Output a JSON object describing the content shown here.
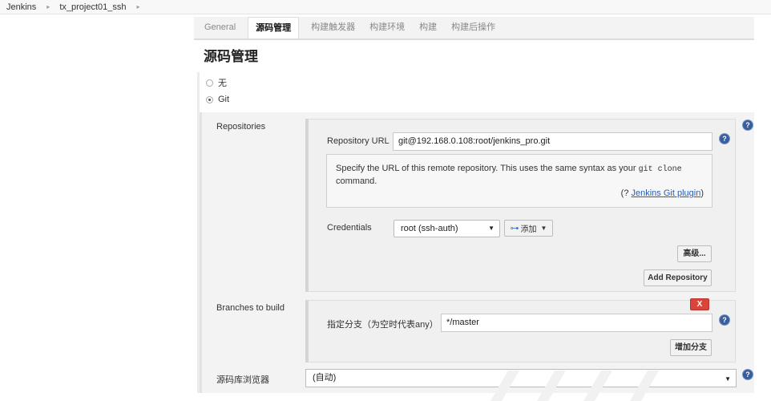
{
  "breadcrumb": {
    "items": [
      "Jenkins",
      "tx_project01_ssh"
    ]
  },
  "tabs": [
    "General",
    "源码管理",
    "构建触发器",
    "构建环境",
    "构建",
    "构建后操作"
  ],
  "active_tab_index": 1,
  "section_title": "源码管理",
  "scm_options": [
    {
      "label": "无",
      "checked": false
    },
    {
      "label": "Git",
      "checked": true
    }
  ],
  "repositories": {
    "label": "Repositories",
    "url_label": "Repository URL",
    "url_value": "git@192.168.0.108:root/jenkins_pro.git",
    "help_text_1": "Specify the URL of this remote repository. This uses the same syntax as your",
    "help_code": "git clone",
    "help_text_2": "command.",
    "help_foot_prefix": "(? ",
    "help_link": "Jenkins Git plugin",
    "help_foot_suffix": ")",
    "credentials_label": "Credentials",
    "credentials_value": "root (ssh-auth)",
    "add_button": "添加",
    "advanced_button": "高级...",
    "add_repository_button": "Add Repository"
  },
  "branches": {
    "label": "Branches to build",
    "delete_button": "X",
    "branch_label": "指定分支（为空时代表any）",
    "branch_value": "*/master",
    "add_branch_button": "增加分支"
  },
  "browser": {
    "label": "源码库浏览器",
    "value": "(自动)"
  },
  "help_icon_glyph": "?",
  "colors": {
    "help_icon": "#3a5d9c",
    "delete_button": "#d9453b",
    "link": "#2a5db0"
  }
}
